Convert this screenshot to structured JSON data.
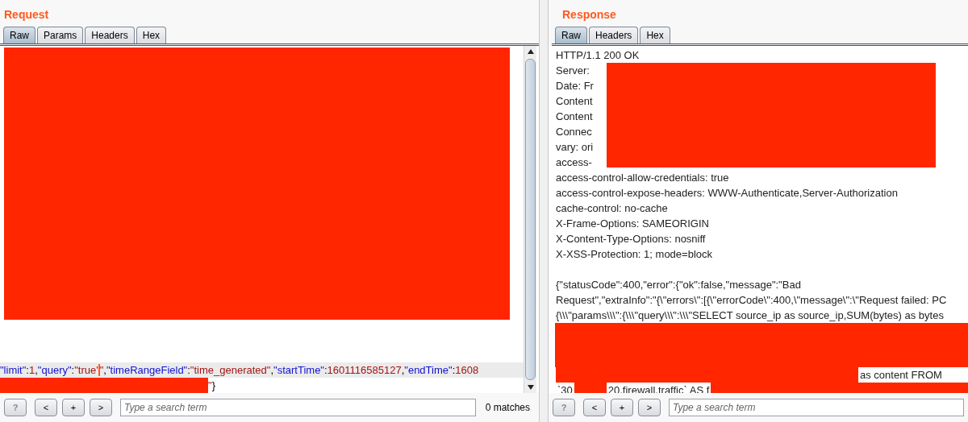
{
  "request": {
    "title": "Request",
    "tabs": [
      {
        "label": "Raw",
        "selected": true
      },
      {
        "label": "Params",
        "selected": false
      },
      {
        "label": "Headers",
        "selected": false
      },
      {
        "label": "Hex",
        "selected": false
      }
    ],
    "lines": [
      {
        "kind": "redaction_block"
      },
      {
        "kind": "blank"
      },
      {
        "kind": "code",
        "current": true,
        "tokens": [
          {
            "kind": "key",
            "text": "\"limit\""
          },
          {
            "kind": "punct",
            "text": ":"
          },
          {
            "kind": "value",
            "text": "1"
          },
          {
            "kind": "punct",
            "text": ","
          },
          {
            "kind": "key",
            "text": "\"query\""
          },
          {
            "kind": "punct",
            "text": ":"
          },
          {
            "kind": "value",
            "text": "\"true'"
          },
          {
            "kind": "caret"
          },
          {
            "kind": "value",
            "text": "\""
          },
          {
            "kind": "punct",
            "text": ","
          },
          {
            "kind": "key",
            "text": "\"timeRangeField\""
          },
          {
            "kind": "punct",
            "text": ":"
          },
          {
            "kind": "value",
            "text": "\"time_generated\""
          },
          {
            "kind": "punct",
            "text": ","
          },
          {
            "kind": "key",
            "text": "\"startTime\""
          },
          {
            "kind": "punct",
            "text": ":"
          },
          {
            "kind": "value",
            "text": "1601116585127"
          },
          {
            "kind": "punct",
            "text": ","
          },
          {
            "kind": "key",
            "text": "\"endTime\""
          },
          {
            "kind": "punct",
            "text": ":"
          },
          {
            "kind": "value",
            "text": "1608"
          }
        ]
      },
      {
        "kind": "code",
        "current": false,
        "tokens": [
          {
            "kind": "redaction"
          },
          {
            "kind": "value",
            "text": "\""
          },
          {
            "kind": "punct",
            "text": "}"
          }
        ]
      }
    ],
    "nav_buttons": [
      "?",
      "<",
      "+",
      ">"
    ],
    "search": {
      "placeholder": "Type a search term"
    },
    "match_count": "0 matches"
  },
  "response": {
    "title": "Response",
    "tabs": [
      {
        "label": "Raw",
        "selected": true
      },
      {
        "label": "Headers",
        "selected": false
      },
      {
        "label": "Hex",
        "selected": false
      }
    ],
    "lines": [
      {
        "kind": "text",
        "text": "HTTP/1.1 200 OK"
      },
      {
        "kind": "text",
        "text": "Server:"
      },
      {
        "kind": "text",
        "text": "Date: Fr"
      },
      {
        "kind": "text",
        "text": "Content"
      },
      {
        "kind": "text",
        "text": "Content"
      },
      {
        "kind": "text",
        "text": "Connec"
      },
      {
        "kind": "text",
        "text": "vary: ori"
      },
      {
        "kind": "text",
        "text": "access-"
      },
      {
        "kind": "text",
        "text": "access-control-allow-credentials: true"
      },
      {
        "kind": "text",
        "text": "access-control-expose-headers: WWW-Authenticate,Server-Authorization"
      },
      {
        "kind": "text",
        "text": "cache-control: no-cache"
      },
      {
        "kind": "text",
        "text": "X-Frame-Options: SAMEORIGIN"
      },
      {
        "kind": "text",
        "text": "X-Content-Type-Options: nosniff"
      },
      {
        "kind": "text",
        "text": "X-XSS-Protection: 1; mode=block"
      },
      {
        "kind": "blank"
      },
      {
        "kind": "text",
        "text": "{\"statusCode\":400,\"error\":{\"ok\":false,\"message\":\"Bad"
      },
      {
        "kind": "text",
        "text": "Request\",\"extraInfo\":\"{\\\"errors\\\":[{\\\"errorCode\\\":400,\\\"message\\\":\\\"Request failed: PC"
      },
      {
        "kind": "text",
        "text": "{\\\\\\\"params\\\\\\\":{\\\\\\\"query\\\\\\\":\\\\\\\"SELECT source_ip as source_ip,SUM(bytes) as bytes"
      },
      {
        "kind": "redaction_block"
      },
      {
        "kind": "parts",
        "parts": [
          {
            "kind": "redaction"
          },
          {
            "kind": "text",
            "text": "as content  FROM"
          }
        ]
      },
      {
        "kind": "parts",
        "parts": [
          {
            "kind": "text",
            "text": "`30"
          },
          {
            "kind": "redaction"
          },
          {
            "kind": "text",
            "text": "20.firewall.traffic` AS f"
          },
          {
            "kind": "redaction"
          }
        ]
      }
    ],
    "nav_buttons": [
      "?",
      "<",
      "+",
      ">"
    ],
    "search": {
      "placeholder": "Type a search term"
    }
  }
}
